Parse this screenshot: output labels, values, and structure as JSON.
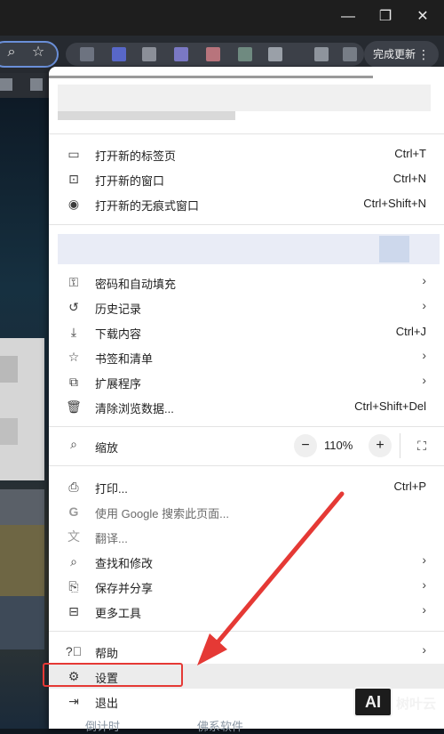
{
  "window": {
    "controls": {
      "minimize_icon": "minimize-icon",
      "restore_icon": "restore-icon",
      "close_icon": "close-icon"
    }
  },
  "toolbar": {
    "update_label": "完成更新",
    "menu_icon": "vertical-dots-icon"
  },
  "menu": {
    "items_group1": [
      {
        "label": "打开新的标签页",
        "shortcut": "Ctrl+T",
        "icon": "new-tab-icon"
      },
      {
        "label": "打开新的窗口",
        "shortcut": "Ctrl+N",
        "icon": "new-window-icon"
      },
      {
        "label": "打开新的无痕式窗口",
        "shortcut": "Ctrl+Shift+N",
        "icon": "incognito-icon"
      }
    ],
    "items_group2": [
      {
        "label": "密码和自动填充",
        "icon": "key-icon",
        "submenu": true
      },
      {
        "label": "历史记录",
        "icon": "history-icon",
        "submenu": true
      },
      {
        "label": "下载内容",
        "shortcut": "Ctrl+J",
        "icon": "download-icon"
      },
      {
        "label": "书签和清单",
        "icon": "star-icon",
        "submenu": true
      },
      {
        "label": "扩展程序",
        "icon": "puzzle-icon",
        "submenu": true
      },
      {
        "label": "清除浏览数据...",
        "shortcut": "Ctrl+Shift+Del",
        "icon": "trash-icon"
      }
    ],
    "zoom": {
      "label": "缩放",
      "value": "110%",
      "minus": "−",
      "plus": "+"
    },
    "items_group3": [
      {
        "label": "打印...",
        "shortcut": "Ctrl+P",
        "icon": "print-icon"
      },
      {
        "label": "使用 Google 搜索此页面...",
        "icon": "google-icon",
        "disabled": true
      },
      {
        "label": "翻译...",
        "icon": "translate-icon",
        "disabled": true
      },
      {
        "label": "查找和修改",
        "icon": "find-icon",
        "submenu": true
      },
      {
        "label": "保存并分享",
        "icon": "save-share-icon",
        "submenu": true
      },
      {
        "label": "更多工具",
        "icon": "toolbox-icon",
        "submenu": true
      }
    ],
    "items_group4": [
      {
        "label": "帮助",
        "icon": "help-icon",
        "submenu": true
      },
      {
        "label": "设置",
        "icon": "gear-icon"
      },
      {
        "label": "退出",
        "icon": "exit-icon"
      }
    ]
  },
  "annotation": {
    "arrow_color": "#e53935"
  },
  "watermark": {
    "logo": "AI",
    "text": "树叶云"
  },
  "background_text": {
    "left": "倒计时",
    "right": "佛系软件"
  }
}
